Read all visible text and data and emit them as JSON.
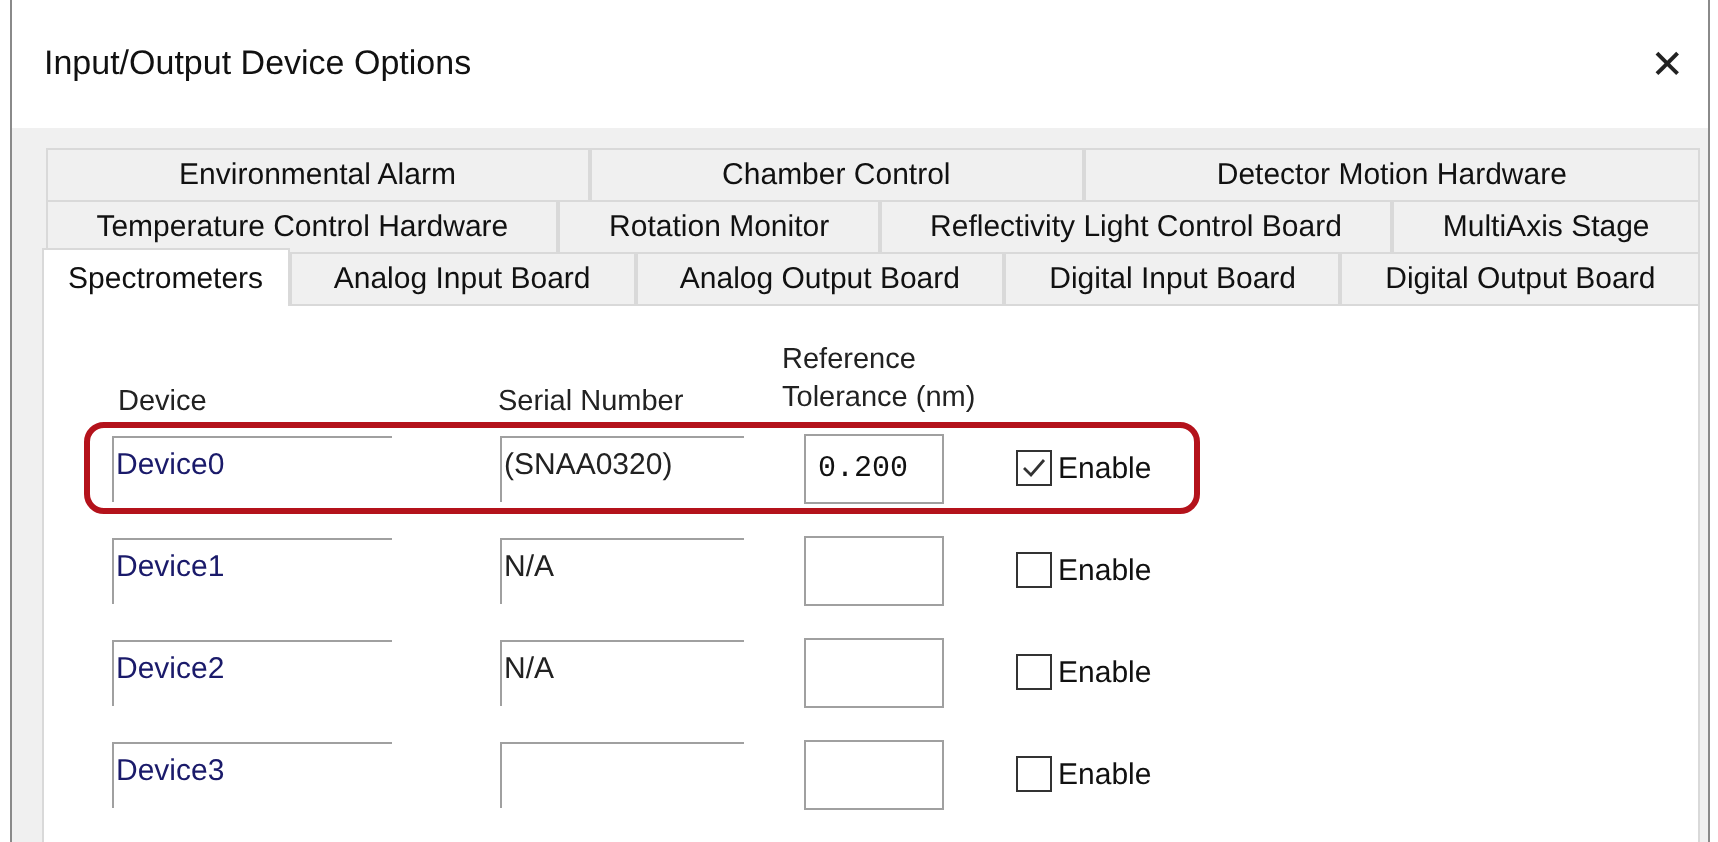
{
  "window": {
    "title": "Input/Output Device Options",
    "close": "✕"
  },
  "tab_rows": [
    [
      {
        "label": "Environmental Alarm",
        "selected": false
      },
      {
        "label": "Chamber Control",
        "selected": false
      },
      {
        "label": "Detector Motion Hardware",
        "selected": false
      }
    ],
    [
      {
        "label": "Temperature Control Hardware",
        "selected": false
      },
      {
        "label": "Rotation Monitor",
        "selected": false
      },
      {
        "label": "Reflectivity Light Control Board",
        "selected": false
      },
      {
        "label": "MultiAxis Stage",
        "selected": false
      }
    ],
    [
      {
        "label": "Spectrometers",
        "selected": true
      },
      {
        "label": "Analog Input Board",
        "selected": false
      },
      {
        "label": "Analog Output Board",
        "selected": false
      },
      {
        "label": "Digital Input Board",
        "selected": false
      },
      {
        "label": "Digital Output Board",
        "selected": false
      }
    ]
  ],
  "columns": [
    "Device",
    "Serial Number",
    "Reference Tolerance (nm)"
  ],
  "rows": [
    {
      "device": "Device0",
      "serial": "(SNAA0320)",
      "tolerance": "0.200",
      "enable_label": "Enable",
      "checked": true,
      "highlighted": true
    },
    {
      "device": "Device1",
      "serial": "N/A",
      "enable_label": "Enable",
      "checked": false,
      "highlighted": false
    },
    {
      "device": "Device2",
      "serial": "N/A",
      "enable_label": "Enable",
      "checked": false,
      "highlighted": false
    },
    {
      "device": "Device3",
      "enable_label": "Enable",
      "checked": false,
      "highlighted": false
    }
  ]
}
